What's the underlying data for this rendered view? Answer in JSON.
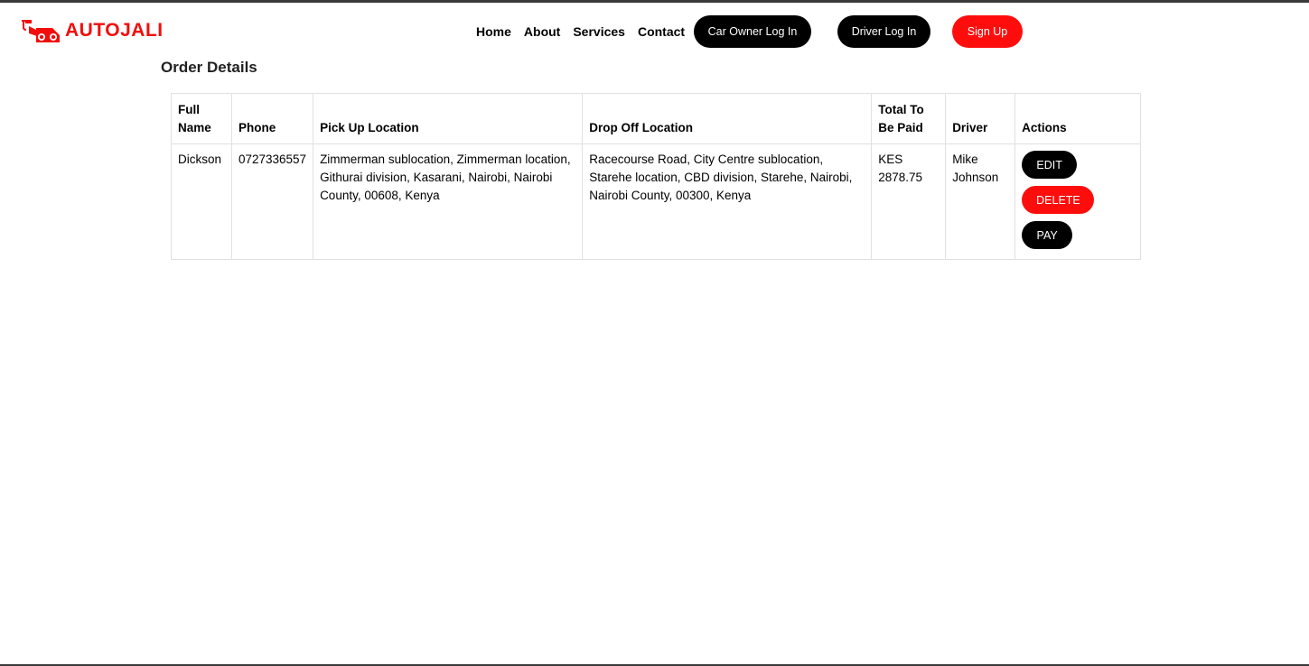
{
  "brand": {
    "name": "AUTOJALI",
    "logo_icon": "tow-truck-icon",
    "accent_color": "#f20d0d"
  },
  "nav": {
    "items": [
      {
        "label": "Home"
      },
      {
        "label": "About"
      },
      {
        "label": "Services"
      },
      {
        "label": "Contact"
      }
    ],
    "car_owner_login": "Car Owner Log In",
    "driver_login": "Driver Log In",
    "sign_up": "Sign Up"
  },
  "main": {
    "title": "Order Details",
    "table": {
      "headers": [
        "Full Name",
        "Phone",
        "Pick Up Location",
        "Drop Off Location",
        "Total To Be Paid",
        "Driver",
        "Actions"
      ],
      "rows": [
        {
          "full_name": "Dickson",
          "phone": "0727336557",
          "pickup": "Zimmerman sublocation, Zimmerman location, Githurai division, Kasarani, Nairobi, Nairobi County, 00608, Kenya",
          "dropoff": "Racecourse Road, City Centre sublocation, Starehe location, CBD division, Starehe, Nairobi, Nairobi County, 00300, Kenya",
          "total": "KES 2878.75",
          "driver": "Mike Johnson",
          "actions": {
            "edit": "EDIT",
            "delete": "DELETE",
            "pay": "PAY"
          }
        }
      ]
    }
  }
}
